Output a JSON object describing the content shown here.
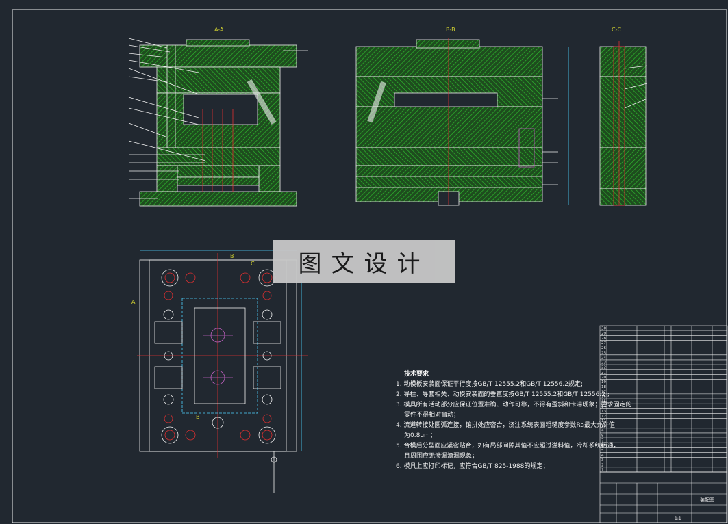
{
  "sheet": {
    "background": "#212830",
    "line_color": "#f0f0f0",
    "hatch_color": "#2eb82e",
    "center_color": "#e03030",
    "dim_color": "#4fd2ff",
    "accent_color": "#d0d030"
  },
  "views": {
    "a_label": "A-A",
    "b_label": "B-B",
    "c_label": "C-C",
    "section_mark_a": "A",
    "section_mark_b": "B",
    "section_mark_c": "C"
  },
  "watermark": "图文设计",
  "tech_notes": {
    "title": "技术要求",
    "items": [
      "1. 动模板安装面保证平行度按GB/T 12555.2和GB/T 12556.2规定;",
      "2. 导柱、导套相关、动模安装面的垂直度按GB/T 12555.2和GB/T 12556.2 ;",
      "3. 模具所有活动部分应保证位置准确、动作可靠，不得有歪斜和卡滞现象；要求固定的",
      "零件不得相对窜动；",
      "4. 流道转接处圆弧连接，镶拼处应密合，浇注系统表面粗糙度参数Ra最大允许值",
      "为0.8um；",
      "5. 合模后分型面应紧密贴合，如有局部间隙其值不应超过溢料值，冷却系统畅通，",
      "且周围应无渗漏滴漏现象；",
      "6. 模具上应打印标记，应符合GB/T 825-1988的规定；"
    ]
  },
  "bom_numbers": [
    "30",
    "29",
    "28",
    "27",
    "26",
    "25",
    "24",
    "23",
    "22",
    "21",
    "20",
    "19",
    "18",
    "17",
    "16",
    "15",
    "14",
    "13",
    "12",
    "11",
    "10",
    "9",
    "8",
    "7",
    "6",
    "5",
    "4",
    "3",
    "2",
    "1"
  ],
  "title_block": {
    "name": "装配图",
    "scale": "1:1"
  }
}
